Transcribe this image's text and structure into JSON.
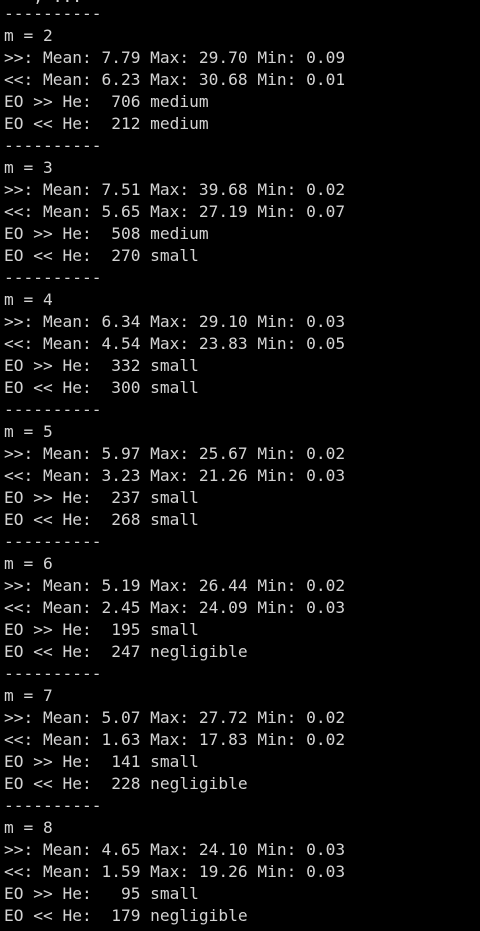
{
  "terminal": {
    "text_color": "#d4d4d4",
    "background_color": "#000000",
    "partial_top_line": "---, ...",
    "lines": [
      "----------",
      "m = 2",
      ">>: Mean: 7.79 Max: 29.70 Min: 0.09",
      "<<: Mean: 6.23 Max: 30.68 Min: 0.01",
      "EO >> He:  706 medium",
      "EO << He:  212 medium",
      "----------",
      "m = 3",
      ">>: Mean: 7.51 Max: 39.68 Min: 0.02",
      "<<: Mean: 5.65 Max: 27.19 Min: 0.07",
      "EO >> He:  508 medium",
      "EO << He:  270 small",
      "----------",
      "m = 4",
      ">>: Mean: 6.34 Max: 29.10 Min: 0.03",
      "<<: Mean: 4.54 Max: 23.83 Min: 0.05",
      "EO >> He:  332 small",
      "EO << He:  300 small",
      "----------",
      "m = 5",
      ">>: Mean: 5.97 Max: 25.67 Min: 0.02",
      "<<: Mean: 3.23 Max: 21.26 Min: 0.03",
      "EO >> He:  237 small",
      "EO << He:  268 small",
      "----------",
      "m = 6",
      ">>: Mean: 5.19 Max: 26.44 Min: 0.02",
      "<<: Mean: 2.45 Max: 24.09 Min: 0.03",
      "EO >> He:  195 small",
      "EO << He:  247 negligible",
      "----------",
      "m = 7",
      ">>: Mean: 5.07 Max: 27.72 Min: 0.02",
      "<<: Mean: 1.63 Max: 17.83 Min: 0.02",
      "EO >> He:  141 small",
      "EO << He:  228 negligible",
      "----------",
      "m = 8",
      ">>: Mean: 4.65 Max: 24.10 Min: 0.03",
      "<<: Mean: 1.59 Max: 19.26 Min: 0.03",
      "EO >> He:   95 small",
      "EO << He:  179 negligible"
    ]
  }
}
